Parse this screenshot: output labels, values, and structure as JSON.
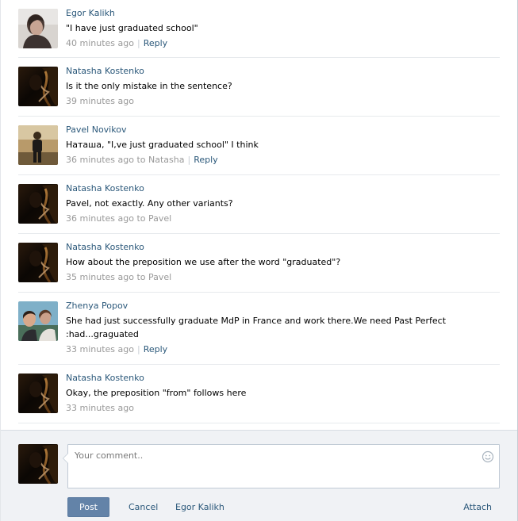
{
  "comments": [
    {
      "author": "Egor Kalikh",
      "text": "\"I have just graduated school\"",
      "time": "40 minutes ago",
      "reply": "Reply",
      "avatar": "woman-photo-icon"
    },
    {
      "author": "Natasha Kostenko",
      "text": "Is it the only mistake in the sentence?",
      "time": "39 minutes ago",
      "avatar": "dark-portrait-icon"
    },
    {
      "author": "Pavel Novikov",
      "text": "Наташа, \"I,ve just graduated school\" I think",
      "time": "36 minutes ago to Natasha",
      "reply": "Reply",
      "avatar": "man-standing-photo-icon"
    },
    {
      "author": "Natasha Kostenko",
      "text": "Pavel, not exactly. Any other variants?",
      "time": "36 minutes ago to Pavel",
      "avatar": "dark-portrait-icon"
    },
    {
      "author": "Natasha Kostenko",
      "text": "How about the preposition we use after the word \"graduated\"?",
      "time": "35 minutes ago to Pavel",
      "avatar": "dark-portrait-icon"
    },
    {
      "author": "Zhenya Popov",
      "text_line1": "She had just successfully graduate MdP in France and work there.We need Past Perfect",
      "text_line2": ":had...graguated",
      "time": "33 minutes ago",
      "reply": "Reply",
      "avatar": "group-selfie-photo-icon"
    },
    {
      "author": "Natasha Kostenko",
      "text": "Okay, the preposition \"from\" follows here",
      "time": "33 minutes ago",
      "avatar": "dark-portrait-icon"
    }
  ],
  "composer": {
    "placeholder": "Your comment..",
    "post_label": "Post",
    "cancel_label": "Cancel",
    "reply_to": "Egor Kalikh",
    "attach_label": "Attach",
    "avatar": "dark-portrait-icon",
    "emoji_icon": "smiley-icon"
  },
  "colors": {
    "link": "#2b587a",
    "meta": "#999999",
    "post_button": "#6383a8",
    "composer_bg": "#f0f2f5"
  }
}
